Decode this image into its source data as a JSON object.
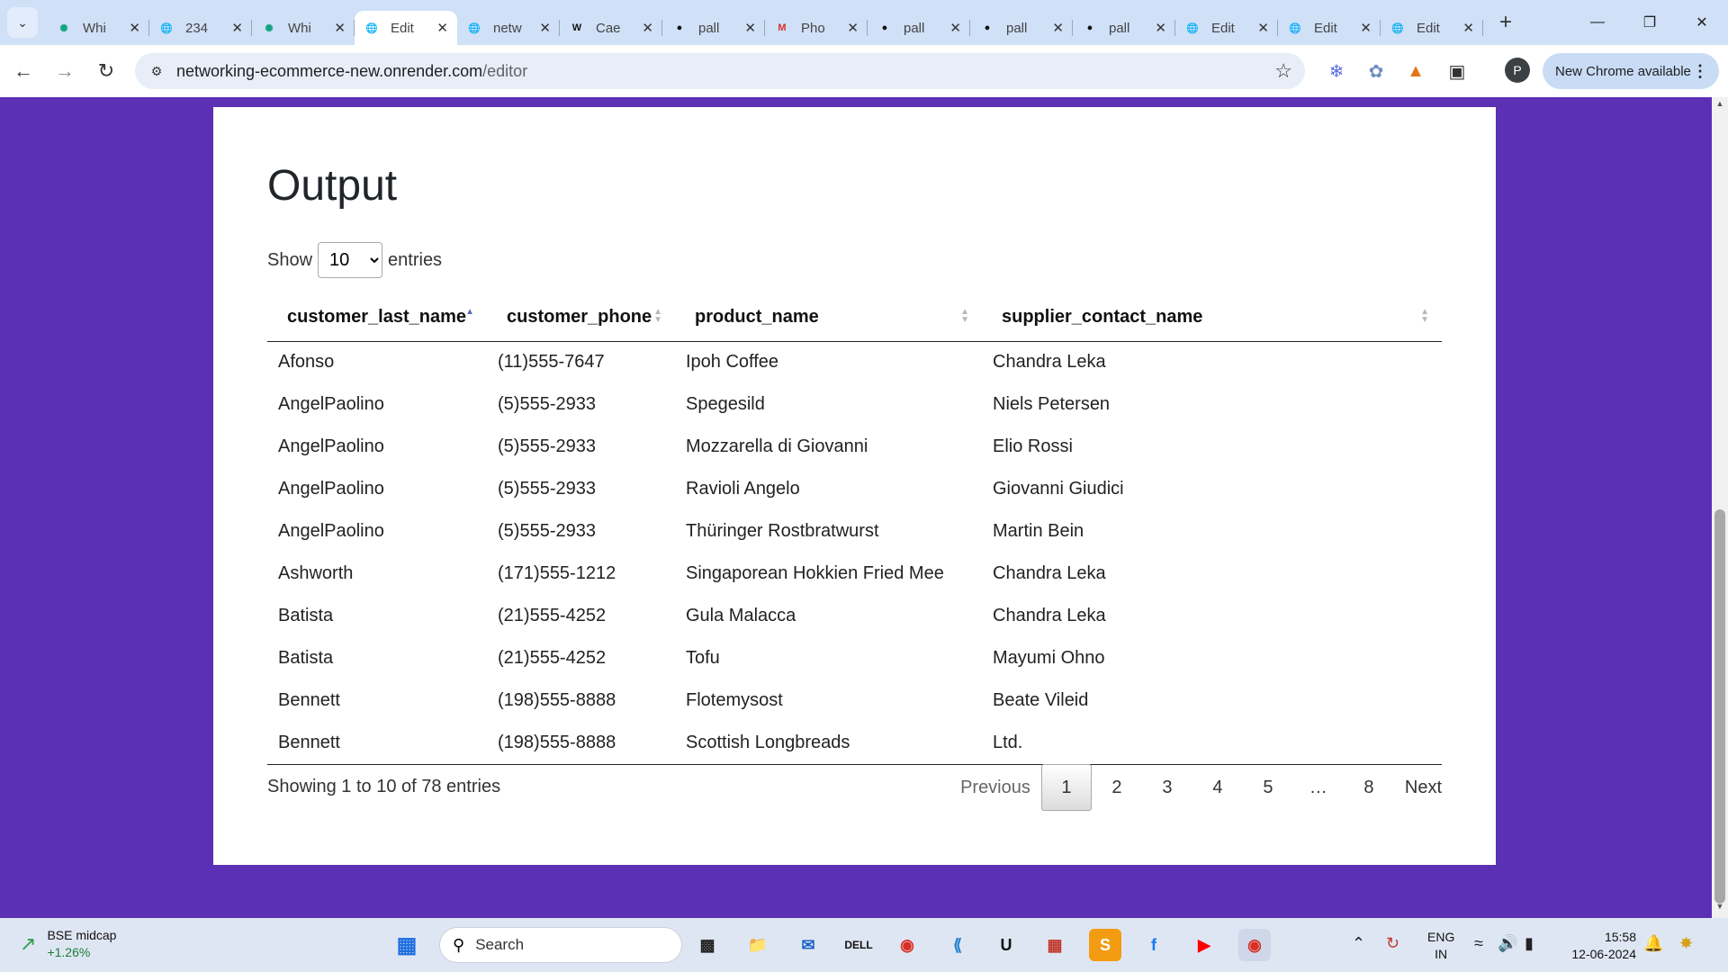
{
  "browser": {
    "tabs": [
      {
        "title": "Whi",
        "icon": "chatgpt-icon",
        "active": false
      },
      {
        "title": "234",
        "icon": "globe-icon",
        "active": false
      },
      {
        "title": "Whi",
        "icon": "chatgpt-icon",
        "active": false
      },
      {
        "title": "Edit",
        "icon": "globe-icon",
        "active": true
      },
      {
        "title": "netw",
        "icon": "globe-icon",
        "active": false
      },
      {
        "title": "Cae",
        "icon": "wikipedia-icon",
        "active": false
      },
      {
        "title": "pall",
        "icon": "github-icon",
        "active": false
      },
      {
        "title": "Pho",
        "icon": "gmail-icon",
        "active": false
      },
      {
        "title": "pall",
        "icon": "github-icon",
        "active": false
      },
      {
        "title": "pall",
        "icon": "github-icon",
        "active": false
      },
      {
        "title": "pall",
        "icon": "github-icon",
        "active": false
      },
      {
        "title": "Edit",
        "icon": "globe-icon",
        "active": false
      },
      {
        "title": "Edit",
        "icon": "globe-icon",
        "active": false
      },
      {
        "title": "Edit",
        "icon": "globe-icon",
        "active": false
      }
    ],
    "url_host": "networking-ecommerce-new.onrender.com",
    "url_path": "/editor",
    "profile_initial": "P",
    "update_label": "New Chrome available"
  },
  "page": {
    "heading": "Output",
    "length": {
      "show_label": "Show",
      "selected": "10",
      "options": [
        "10"
      ],
      "entries_label": "entries"
    },
    "table": {
      "columns": [
        {
          "label": "customer_last_name",
          "sorted": "asc"
        },
        {
          "label": "customer_phone",
          "sorted": "none"
        },
        {
          "label": "product_name",
          "sorted": "none"
        },
        {
          "label": "supplier_contact_name",
          "sorted": "none"
        }
      ],
      "rows": [
        [
          "Afonso",
          "(11)555-7647",
          "Ipoh Coffee",
          "Chandra Leka"
        ],
        [
          "AngelPaolino",
          "(5)555-2933",
          "Spegesild",
          "Niels Petersen"
        ],
        [
          "AngelPaolino",
          "(5)555-2933",
          "Mozzarella di Giovanni",
          "Elio Rossi"
        ],
        [
          "AngelPaolino",
          "(5)555-2933",
          "Ravioli Angelo",
          "Giovanni Giudici"
        ],
        [
          "AngelPaolino",
          "(5)555-2933",
          "Thüringer Rostbratwurst",
          "Martin Bein"
        ],
        [
          "Ashworth",
          "(171)555-1212",
          "Singaporean Hokkien Fried Mee",
          "Chandra Leka"
        ],
        [
          "Batista",
          "(21)555-4252",
          "Gula Malacca",
          "Chandra Leka"
        ],
        [
          "Batista",
          "(21)555-4252",
          "Tofu",
          "Mayumi Ohno"
        ],
        [
          "Bennett",
          "(198)555-8888",
          "Flotemysost",
          "Beate Vileid"
        ],
        [
          "Bennett",
          "(198)555-8888",
          "Scottish Longbreads",
          "Ltd."
        ]
      ]
    },
    "info": "Showing 1 to 10 of 78 entries",
    "pagination": {
      "previous": "Previous",
      "pages": [
        "1",
        "2",
        "3",
        "4",
        "5",
        "…",
        "8"
      ],
      "current": "1",
      "next": "Next"
    }
  },
  "taskbar": {
    "ticker_name": "BSE midcap",
    "ticker_change": "+1.26%",
    "search_label": "Search",
    "lang_top": "ENG",
    "lang_bottom": "IN",
    "time": "15:58",
    "date": "12-06-2024"
  },
  "colors": {
    "page_bg": "#5b30b5",
    "sort_active": "#5a6fc2"
  }
}
